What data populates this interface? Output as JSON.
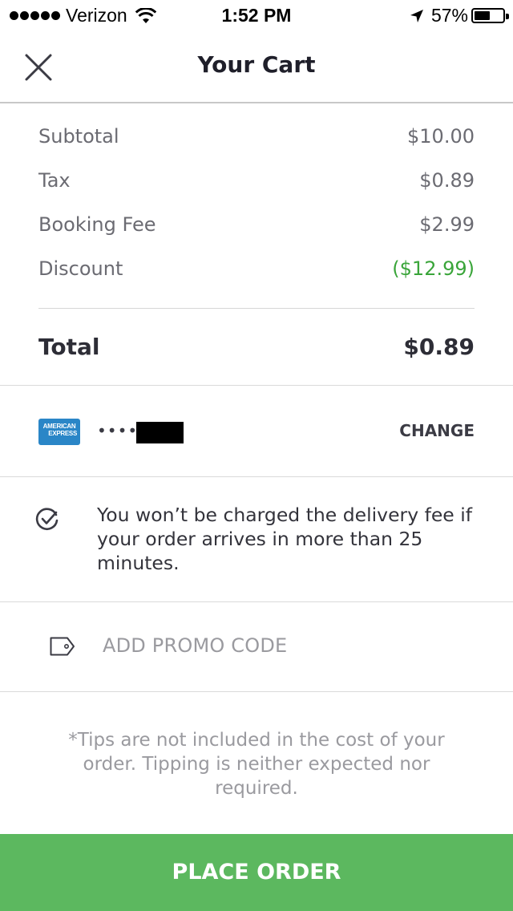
{
  "status_bar": {
    "carrier": "Verizon",
    "signal_bars": 5,
    "time": "1:52 PM",
    "battery_percent_label": "57%",
    "battery_level": 0.57,
    "icons": [
      "signal-dots-icon",
      "wifi-icon",
      "location-arrow-icon",
      "battery-icon"
    ]
  },
  "header": {
    "title": "Your Cart",
    "close_icon": "close-icon"
  },
  "breakdown": {
    "items": [
      {
        "label": "Subtotal",
        "value": "$10.00"
      },
      {
        "label": "Tax",
        "value": "$0.89"
      },
      {
        "label": "Booking Fee",
        "value": "$2.99"
      },
      {
        "label": "Discount",
        "value": "($12.99)"
      }
    ],
    "total_label": "Total",
    "total_value": "$0.89"
  },
  "payment": {
    "card_brand": "American Express",
    "card_logo_line1": "AMERICAN",
    "card_logo_line2": "EXPRESS",
    "masked_number": "••••",
    "change_label": "CHANGE"
  },
  "guarantee": {
    "icon": "check-circle-icon",
    "text": "You won’t be charged the delivery fee if your order arrives in more than 25 minutes."
  },
  "promo": {
    "icon": "tag-icon",
    "label": "ADD PROMO CODE"
  },
  "tips_notice": "*Tips are not included in the cost of your order. Tipping is neither expected nor required.",
  "place_order_label": "PLACE ORDER",
  "colors": {
    "accent_green": "#5cb85f",
    "discount_green": "#3aa53a",
    "amex_blue": "#2a86c7",
    "muted_text": "#9a9a9f"
  }
}
